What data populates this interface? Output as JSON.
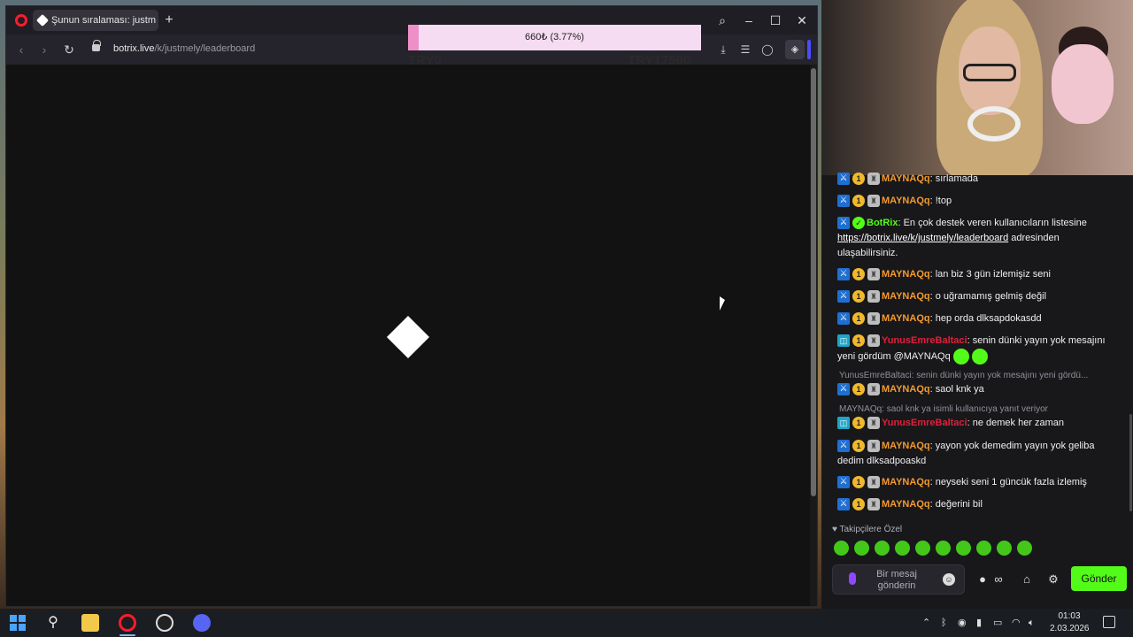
{
  "browser": {
    "tab_title": "Şunun sıralaması: justmely",
    "new_tab_icon": "plus-icon",
    "url_domain": "botrix.live",
    "url_path": "/k/justmely/leaderboard"
  },
  "overlay": {
    "goal_text": "660₺ (3.77%)",
    "goal_progress_percent": 3.77,
    "goal_min": "TRY0",
    "goal_max": "TRY17500"
  },
  "chat": {
    "messages": [
      {
        "user": "MAYNAQq",
        "text": ": sırlamada"
      },
      {
        "user": "MAYNAQq",
        "text": ": !top"
      },
      {
        "user": "BotRix",
        "text": ": En çok destek veren kullanıcıların listesine ",
        "link": "https://botrix.live/k/justmely/leaderboard",
        "after": " adresinden ulaşabilirsiniz."
      },
      {
        "user": "MAYNAQq",
        "text": ": lan biz 3 gün izlemişiz seni"
      },
      {
        "user": "MAYNAQq",
        "text": ": o uğramamış gelmiş değil"
      },
      {
        "user": "MAYNAQq",
        "text": ": hep orda dlksapdokasdd"
      },
      {
        "user": "YunusEmreBaltaci",
        "text": ": senin dünki yayın yok mesajını yeni gördüm @MAYNAQq"
      },
      {
        "reply": "YunusEmreBaltaci: senin dünki yayın yok mesajını yeni gördü..."
      },
      {
        "user": "MAYNAQq",
        "text": ": saol knk ya"
      },
      {
        "reply": "MAYNAQq: saol knk ya isimli kullanıcıya yanıt veriyor"
      },
      {
        "user": "YunusEmreBaltaci",
        "text": ": ne demek her zaman"
      },
      {
        "user": "MAYNAQq",
        "text": ": yayon yok demedim yayın yok geliba dedim dlksadpoaskd"
      },
      {
        "user": "MAYNAQq",
        "text": ": neyseki seni 1 güncük fazla izlemiş"
      },
      {
        "user": "MAYNAQq",
        "text": ": değerini bil"
      }
    ],
    "followers_label": "Takipçilere Özel",
    "input_placeholder": "Bir mesaj gönderin",
    "send_label": "Gönder"
  },
  "taskbar": {
    "time": "01:03",
    "date": "2.03.2026"
  },
  "colors": {
    "kick_green": "#53fc18",
    "username_orange": "#f39a2e",
    "username_red": "#e0203a",
    "goal_pink": "#ef8fc7"
  }
}
